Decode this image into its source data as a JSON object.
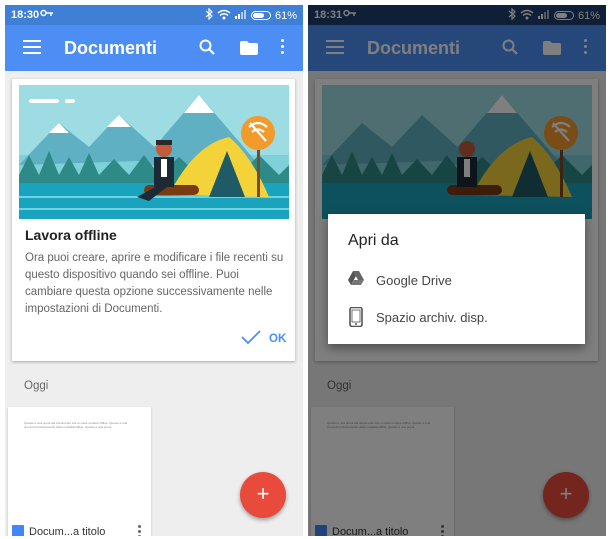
{
  "left": {
    "status": {
      "time": "18:30",
      "battery": "61%"
    },
    "appbar": {
      "title": "Documenti"
    },
    "card": {
      "title": "Lavora offline",
      "body": "Ora puoi creare, aprire e modificare i file recenti su questo dispositivo quando sei offline. Puoi cambiare questa opzione successivamente nelle impostazioni di Documenti.",
      "ok_label": "OK"
    },
    "section_label": "Oggi",
    "doc": {
      "name": "Docum...a titolo",
      "preview": "Questo è una prova del documento che si vuole rendere offline. Questo è una prova di funzionamento della modalità offline. Questo è una prova."
    },
    "fab_label": "+"
  },
  "right": {
    "status": {
      "time": "18:31",
      "battery": "61%"
    },
    "appbar": {
      "title": "Documenti"
    },
    "section_label": "Oggi",
    "doc": {
      "name": "Docum...a titolo"
    },
    "fab_label": "+",
    "dialog": {
      "title": "Apri da",
      "items": [
        {
          "label": "Google Drive",
          "icon": "google-drive-icon"
        },
        {
          "label": "Spazio archiv. disp.",
          "icon": "phone-icon"
        }
      ]
    }
  },
  "colors": {
    "appbar": "#4d8ef5",
    "status_bar": "#3f7fd6",
    "fab": "#e84a3c",
    "accent": "#4d8ef5"
  }
}
